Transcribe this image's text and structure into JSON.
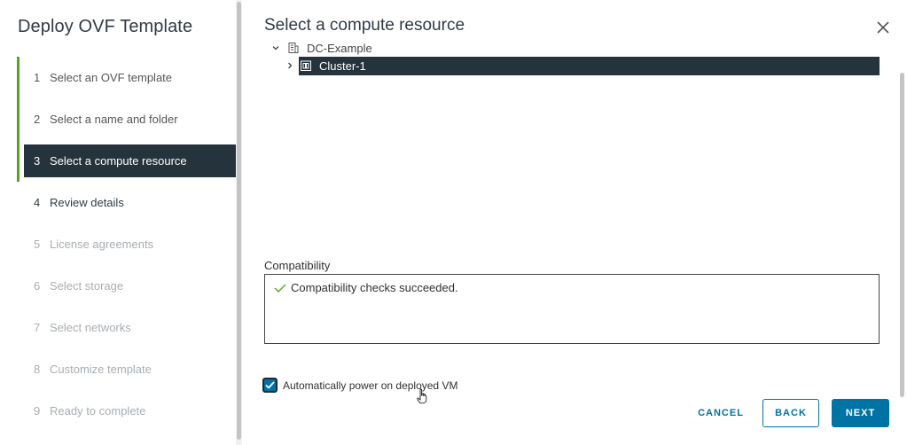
{
  "wizard": {
    "title": "Deploy OVF Template",
    "steps": [
      {
        "num": "1",
        "label": "Select an OVF template",
        "state": "done"
      },
      {
        "num": "2",
        "label": "Select a name and folder",
        "state": "done"
      },
      {
        "num": "3",
        "label": "Select a compute resource",
        "state": "current"
      },
      {
        "num": "4",
        "label": "Review details",
        "state": "next"
      },
      {
        "num": "5",
        "label": "License agreements",
        "state": "disabled"
      },
      {
        "num": "6",
        "label": "Select storage",
        "state": "disabled"
      },
      {
        "num": "7",
        "label": "Select networks",
        "state": "disabled"
      },
      {
        "num": "8",
        "label": "Customize template",
        "state": "disabled"
      },
      {
        "num": "9",
        "label": "Ready to complete",
        "state": "disabled"
      }
    ]
  },
  "main": {
    "title": "Select a compute resource",
    "tree": {
      "datacenter": {
        "label": "DC-Example",
        "icon": "datacenter-icon",
        "expanded": true
      },
      "cluster": {
        "label": "Cluster-1",
        "icon": "cluster-icon",
        "selected": true,
        "expanded": false
      }
    },
    "compatibility": {
      "label": "Compatibility",
      "message": "Compatibility checks succeeded.",
      "status_color": "#5aa220"
    },
    "power_on": {
      "label": "Automatically power on deployed VM",
      "checked": true
    }
  },
  "buttons": {
    "cancel": "CANCEL",
    "back": "BACK",
    "next": "NEXT"
  },
  "colors": {
    "accent": "#0072a3",
    "selected_bg": "#25333d",
    "progress_bar": "#5aa220"
  }
}
